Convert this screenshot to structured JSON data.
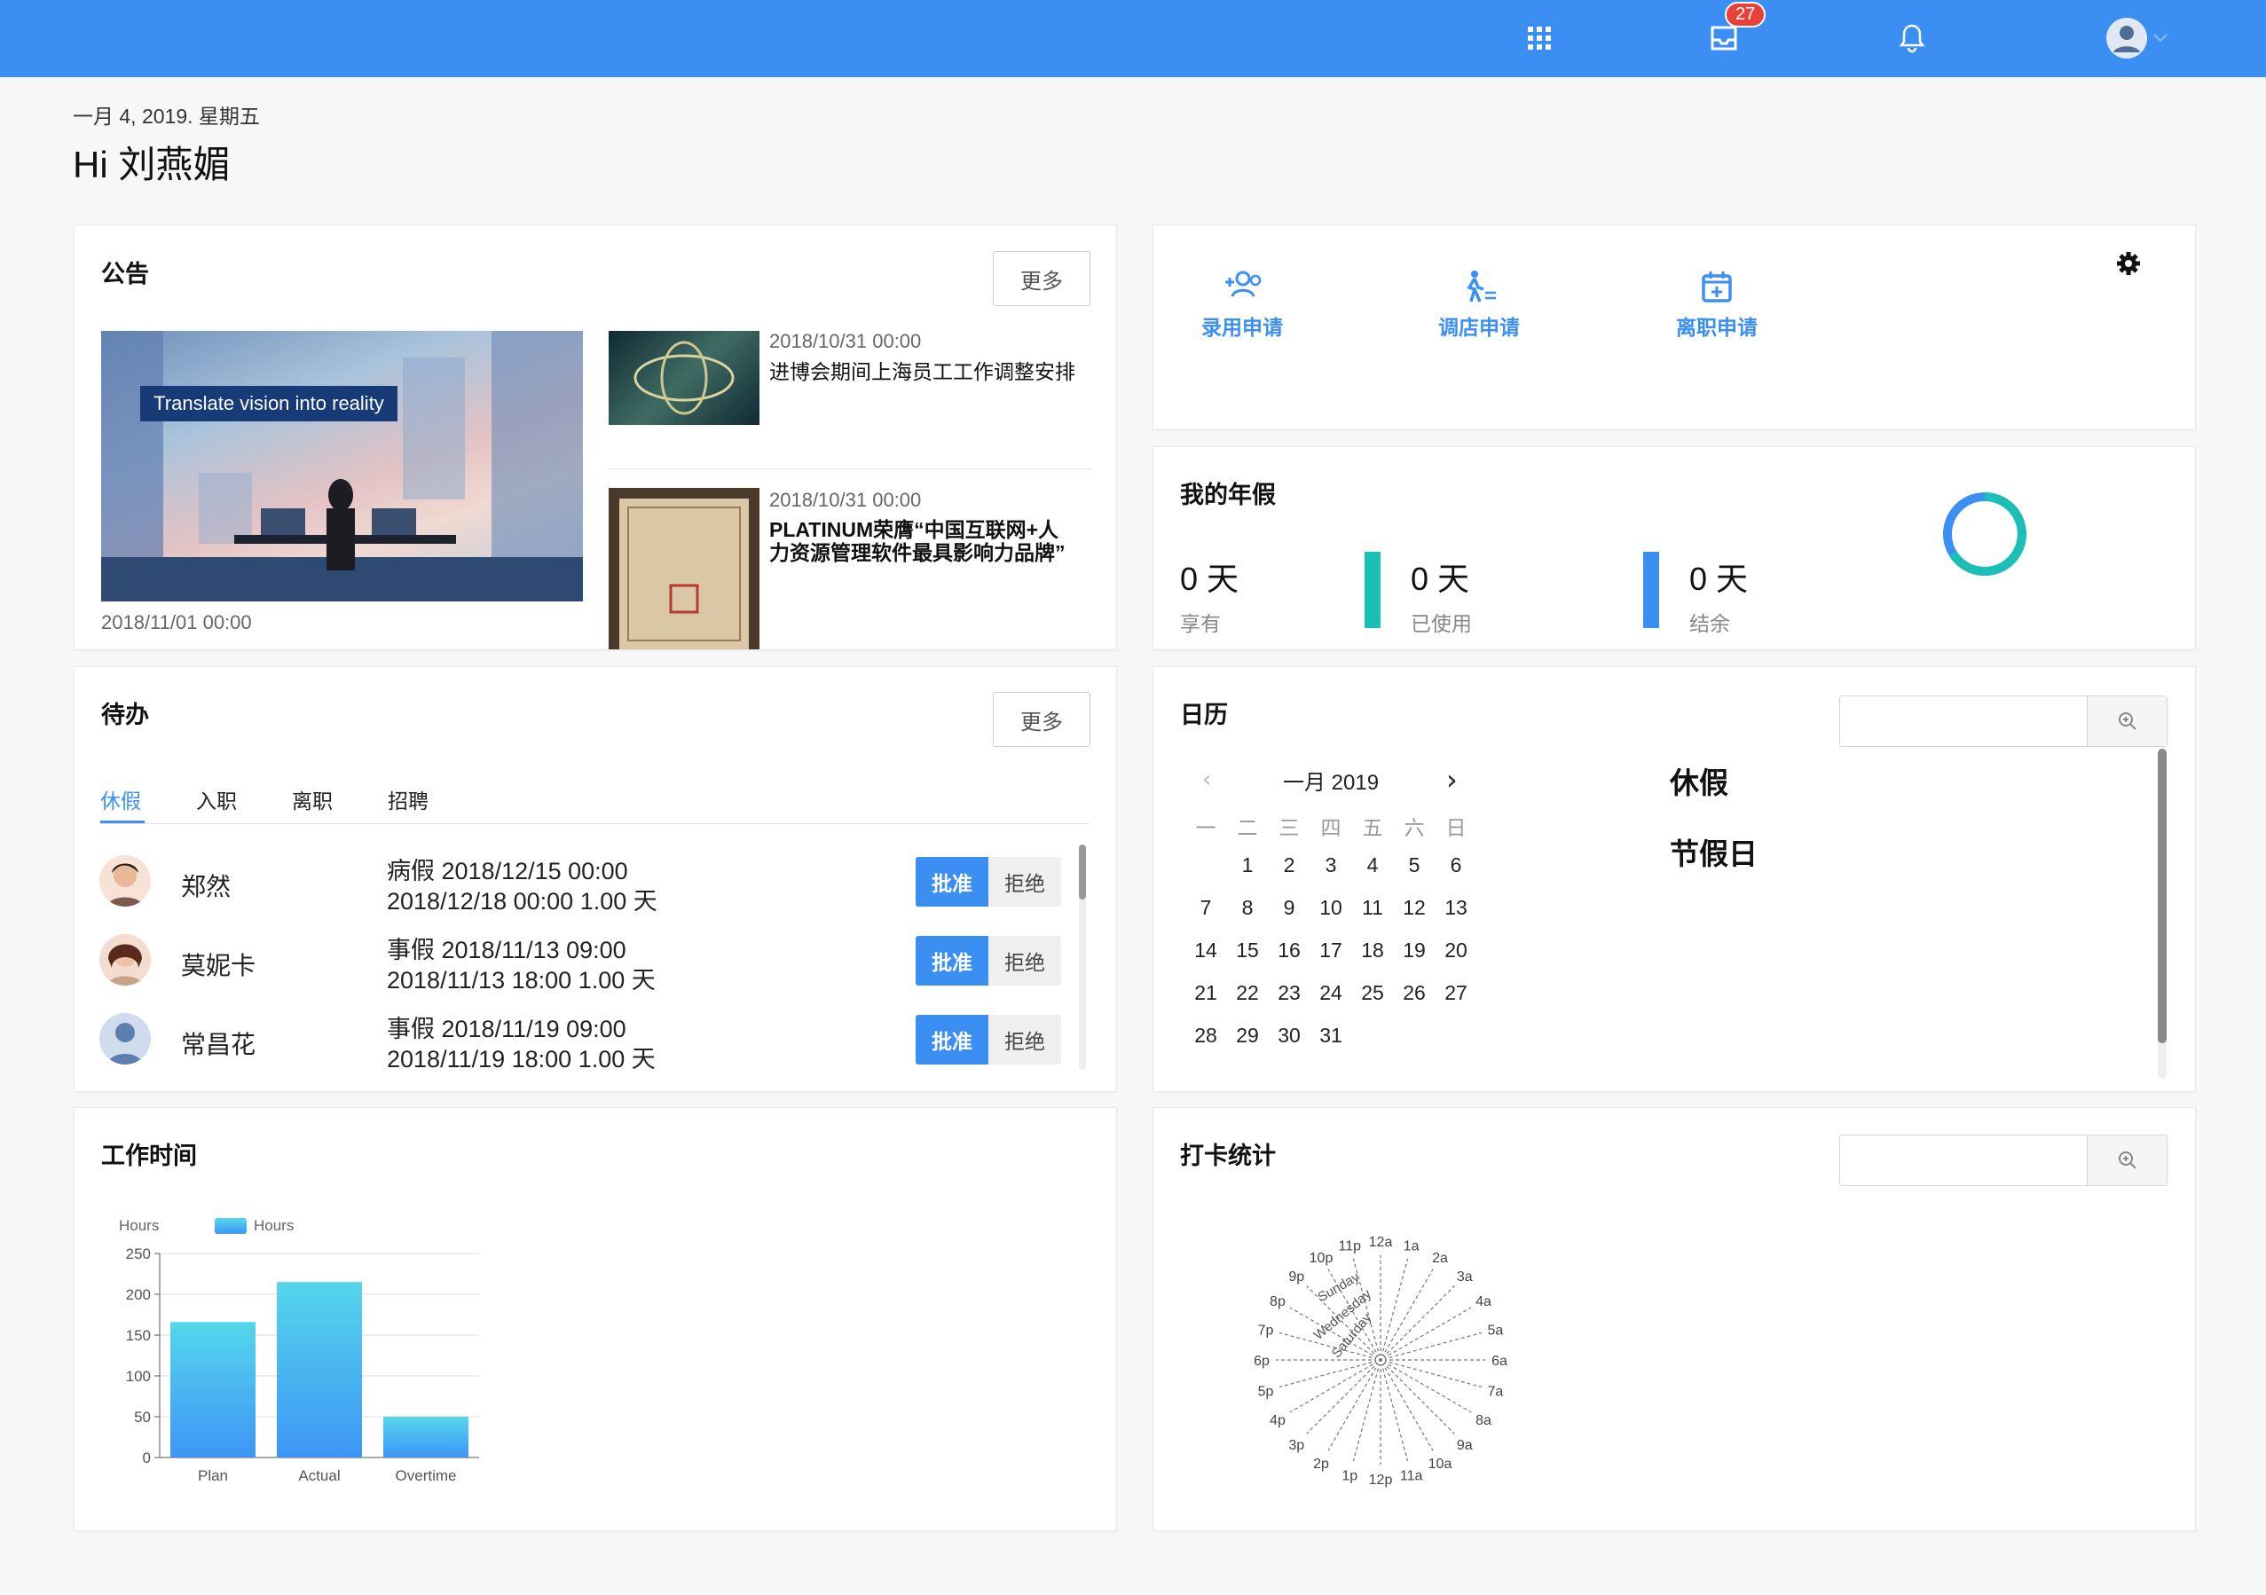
{
  "topbar": {
    "accent": "#3c8ff2",
    "apps_icon": "apps-grid-icon",
    "inbox_icon": "inbox-icon",
    "inbox_badge": "27",
    "bell_icon": "bell-icon",
    "avatar_icon": "user-avatar-icon"
  },
  "header": {
    "date": "一月 4, 2019. 星期五",
    "greeting": "Hi 刘燕媚"
  },
  "announcements": {
    "title": "公告",
    "more": "更多",
    "hero_banner": "Translate vision into reality",
    "hero_date": "2018/11/01 00:00",
    "items": [
      {
        "date": "2018/10/31 00:00",
        "title": "进博会期间上海员工工作调整安排"
      },
      {
        "date": "2018/10/31 00:00",
        "title_line1": "PLATINUM荣膺“中国互联网+人",
        "title_line2": "力资源管理软件最具影响力品牌”"
      }
    ]
  },
  "quick_apply": {
    "items": [
      {
        "label": "录用申请",
        "icon": "add-user-icon"
      },
      {
        "label": "调店申请",
        "icon": "transfer-walk-icon"
      },
      {
        "label": "离职申请",
        "icon": "calendar-plus-icon"
      }
    ],
    "settings_icon": "gear-icon"
  },
  "leave": {
    "title": "我的年假",
    "stats": [
      {
        "value": "0 天",
        "label": "享有"
      },
      {
        "value": "0 天",
        "label": "已使用",
        "color": "#1bbfb5"
      },
      {
        "value": "0 天",
        "label": "结余",
        "color": "#3c8ff2"
      }
    ],
    "ring_colors": [
      "#1bbfb5",
      "#3c8ff2"
    ]
  },
  "todo": {
    "title": "待办",
    "more": "更多",
    "tabs": [
      "休假",
      "入职",
      "离职",
      "招聘"
    ],
    "active_tab": "休假",
    "approve": "批准",
    "reject": "拒绝",
    "rows": [
      {
        "name": "郑然",
        "line1": "病假 2018/12/15 00:00",
        "line2": "2018/12/18 00:00 1.00 天"
      },
      {
        "name": "莫妮卡",
        "line1": "事假 2018/11/13 09:00",
        "line2": "2018/11/13 18:00 1.00 天"
      },
      {
        "name": "常昌花",
        "line1": "事假 2018/11/19 09:00",
        "line2": "2018/11/19 18:00 1.00 天"
      }
    ]
  },
  "calendar": {
    "title": "日历",
    "month": "一月 2019",
    "weekdays": [
      "一",
      "二",
      "三",
      "四",
      "五",
      "六",
      "日"
    ],
    "weeks": [
      [
        "",
        "1",
        "2",
        "3",
        "4",
        "5",
        "6"
      ],
      [
        "7",
        "8",
        "9",
        "10",
        "11",
        "12",
        "13"
      ],
      [
        "14",
        "15",
        "16",
        "17",
        "18",
        "19",
        "20"
      ],
      [
        "21",
        "22",
        "23",
        "24",
        "25",
        "26",
        "27"
      ],
      [
        "28",
        "29",
        "30",
        "31",
        "",
        "",
        ""
      ]
    ],
    "legend": [
      "休假",
      "节假日"
    ]
  },
  "worktime": {
    "title": "工作时间"
  },
  "chart_data": {
    "type": "bar",
    "categories": [
      "Plan",
      "Actual",
      "Overtime"
    ],
    "series": [
      {
        "name": "Hours",
        "values": [
          166,
          215,
          50
        ]
      }
    ],
    "ylabel": "Hours",
    "ylim": [
      0,
      250
    ],
    "yticks": [
      0,
      50,
      100,
      150,
      200,
      250
    ],
    "legend": "top",
    "grid": true,
    "colors": [
      "#55d6ec",
      "#3d96f5"
    ]
  },
  "punch": {
    "title": "打卡统计",
    "hours": [
      "12a",
      "1a",
      "2a",
      "3a",
      "4a",
      "5a",
      "6a",
      "7a",
      "8a",
      "9a",
      "10a",
      "11a",
      "12p",
      "1p",
      "2p",
      "3p",
      "4p",
      "5p",
      "6p",
      "7p",
      "8p",
      "9p",
      "10p",
      "11p"
    ],
    "days": [
      "Sunday",
      "Wednesday",
      "Saturday"
    ]
  }
}
